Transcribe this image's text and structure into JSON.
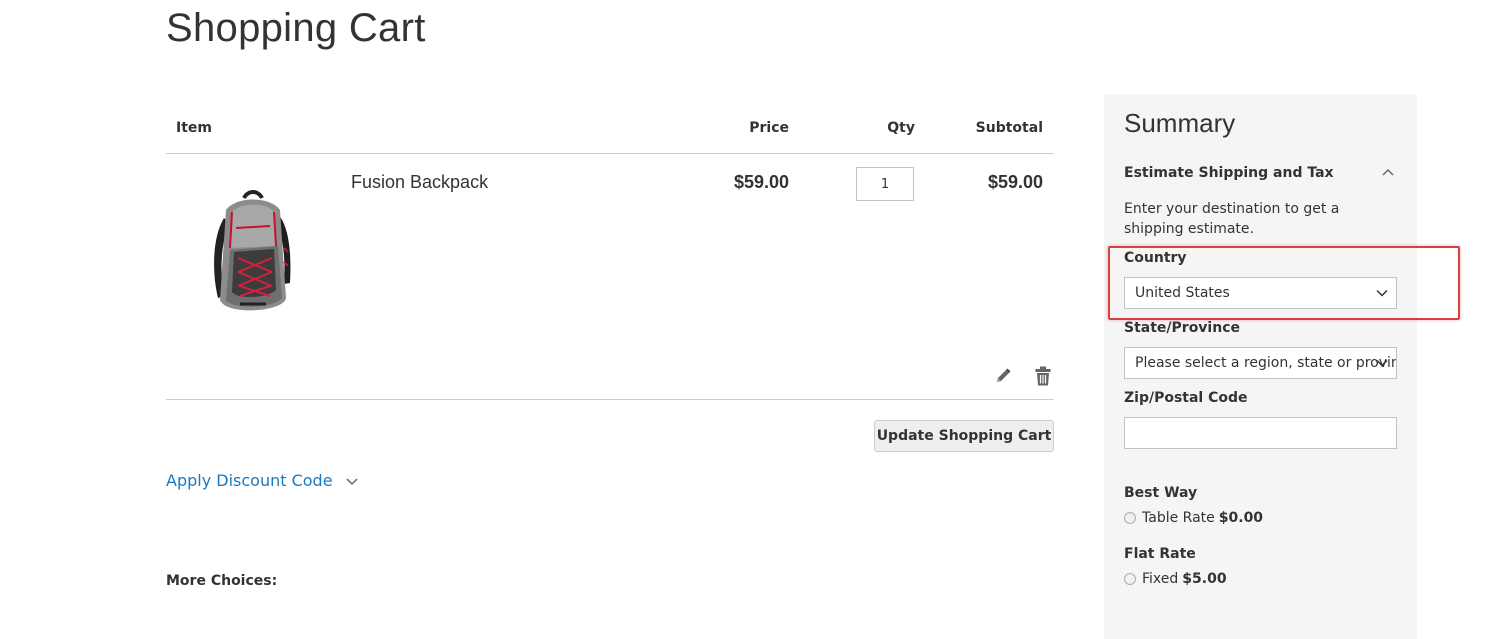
{
  "page": {
    "title": "Shopping Cart"
  },
  "cart": {
    "headers": {
      "item": "Item",
      "price": "Price",
      "qty": "Qty",
      "subtotal": "Subtotal"
    },
    "items": [
      {
        "name": "Fusion Backpack",
        "price": "$59.00",
        "qty": "1",
        "subtotal": "$59.00",
        "image_icon": "backpack-image"
      }
    ],
    "actions": {
      "edit_icon": "pencil-icon",
      "delete_icon": "trash-icon"
    },
    "update_label": "Update Shopping Cart"
  },
  "discount": {
    "label": "Apply Discount Code"
  },
  "more_choices": {
    "label": "More Choices:"
  },
  "summary": {
    "title": "Summary",
    "estimate": {
      "title": "Estimate Shipping and Tax",
      "description": "Enter your destination to get a shipping estimate.",
      "country_label": "Country",
      "country_value": "United States",
      "state_label": "State/Province",
      "state_placeholder": "Please select a region, state or province.",
      "zip_label": "Zip/Postal Code",
      "zip_value": ""
    },
    "carriers": [
      {
        "title": "Best Way",
        "method": "Table Rate",
        "amount": "$0.00"
      },
      {
        "title": "Flat Rate",
        "method": "Fixed",
        "amount": "$5.00"
      }
    ]
  },
  "colors": {
    "link": "#1979c3",
    "highlight": "#d94040",
    "summary_bg": "#f5f5f5"
  }
}
